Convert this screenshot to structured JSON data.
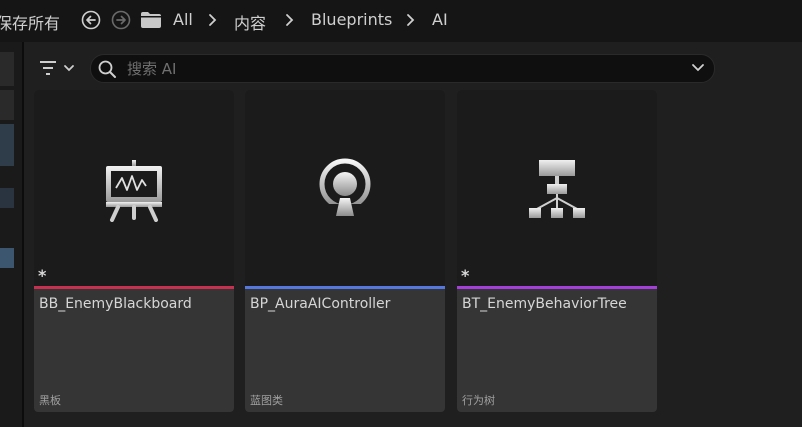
{
  "toolbar": {
    "save_all_label": "保存所有"
  },
  "breadcrumb": [
    "All",
    "内容",
    "Blueprints",
    "AI"
  ],
  "search": {
    "placeholder": "搜索 AI",
    "value": ""
  },
  "assets": [
    {
      "name": "BB_EnemyBlackboard",
      "type": "黑板",
      "modified_marker": "*",
      "accent": "#c8304f",
      "icon": "blackboard-icon"
    },
    {
      "name": "BP_AuraAIController",
      "type": "蓝图类",
      "modified_marker": "",
      "accent": "#5577e0",
      "icon": "ai-controller-icon"
    },
    {
      "name": "BT_EnemyBehaviorTree",
      "type": "行为树",
      "modified_marker": "*",
      "accent": "#a43fdc",
      "icon": "behavior-tree-icon"
    }
  ],
  "colors": {
    "background": "#151515",
    "panel": "#1f1f1f",
    "card": "#353535"
  }
}
